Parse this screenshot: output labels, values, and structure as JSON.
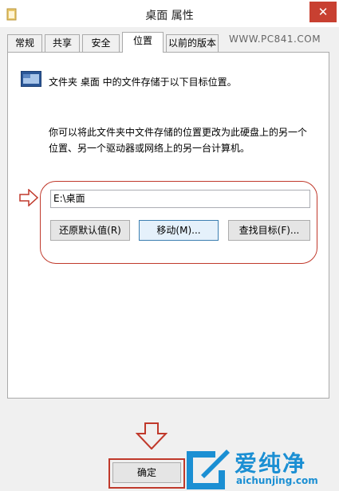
{
  "window": {
    "title": "桌面 属性",
    "close_glyph": "✕"
  },
  "tabs": [
    {
      "label": "常规",
      "active": false
    },
    {
      "label": "共享",
      "active": false
    },
    {
      "label": "安全",
      "active": false
    },
    {
      "label": "位置",
      "active": true
    },
    {
      "label": "以前的版本",
      "active": false
    }
  ],
  "watermark_top": "WWW.PC841.COM",
  "location": {
    "description": "文件夹 桌面 中的文件存储于以下目标位置。",
    "instructions_line1": "你可以将此文件夹中文件存储的位置更改为此硬盘上的另一个",
    "instructions_line2": "位置、另一个驱动器或网络上的另一台计算机。",
    "path_value": "E:\\桌面",
    "restore_default_label": "还原默认值(R)",
    "move_label": "移动(M)...",
    "find_target_label": "查找目标(F)..."
  },
  "footer": {
    "ok_label": "确定"
  },
  "logo": {
    "text_cn": "爱纯净",
    "url": "aichunjing.com"
  },
  "colors": {
    "highlight_red": "#c0392b",
    "close_red": "#c84031",
    "logo_blue": "#1b8fd3"
  },
  "icons": {
    "title": "folder-icon",
    "folder": "desktop-folder-icon",
    "pointer": "arrow-right-outline-icon",
    "pointer_down": "arrow-down-outline-icon"
  }
}
